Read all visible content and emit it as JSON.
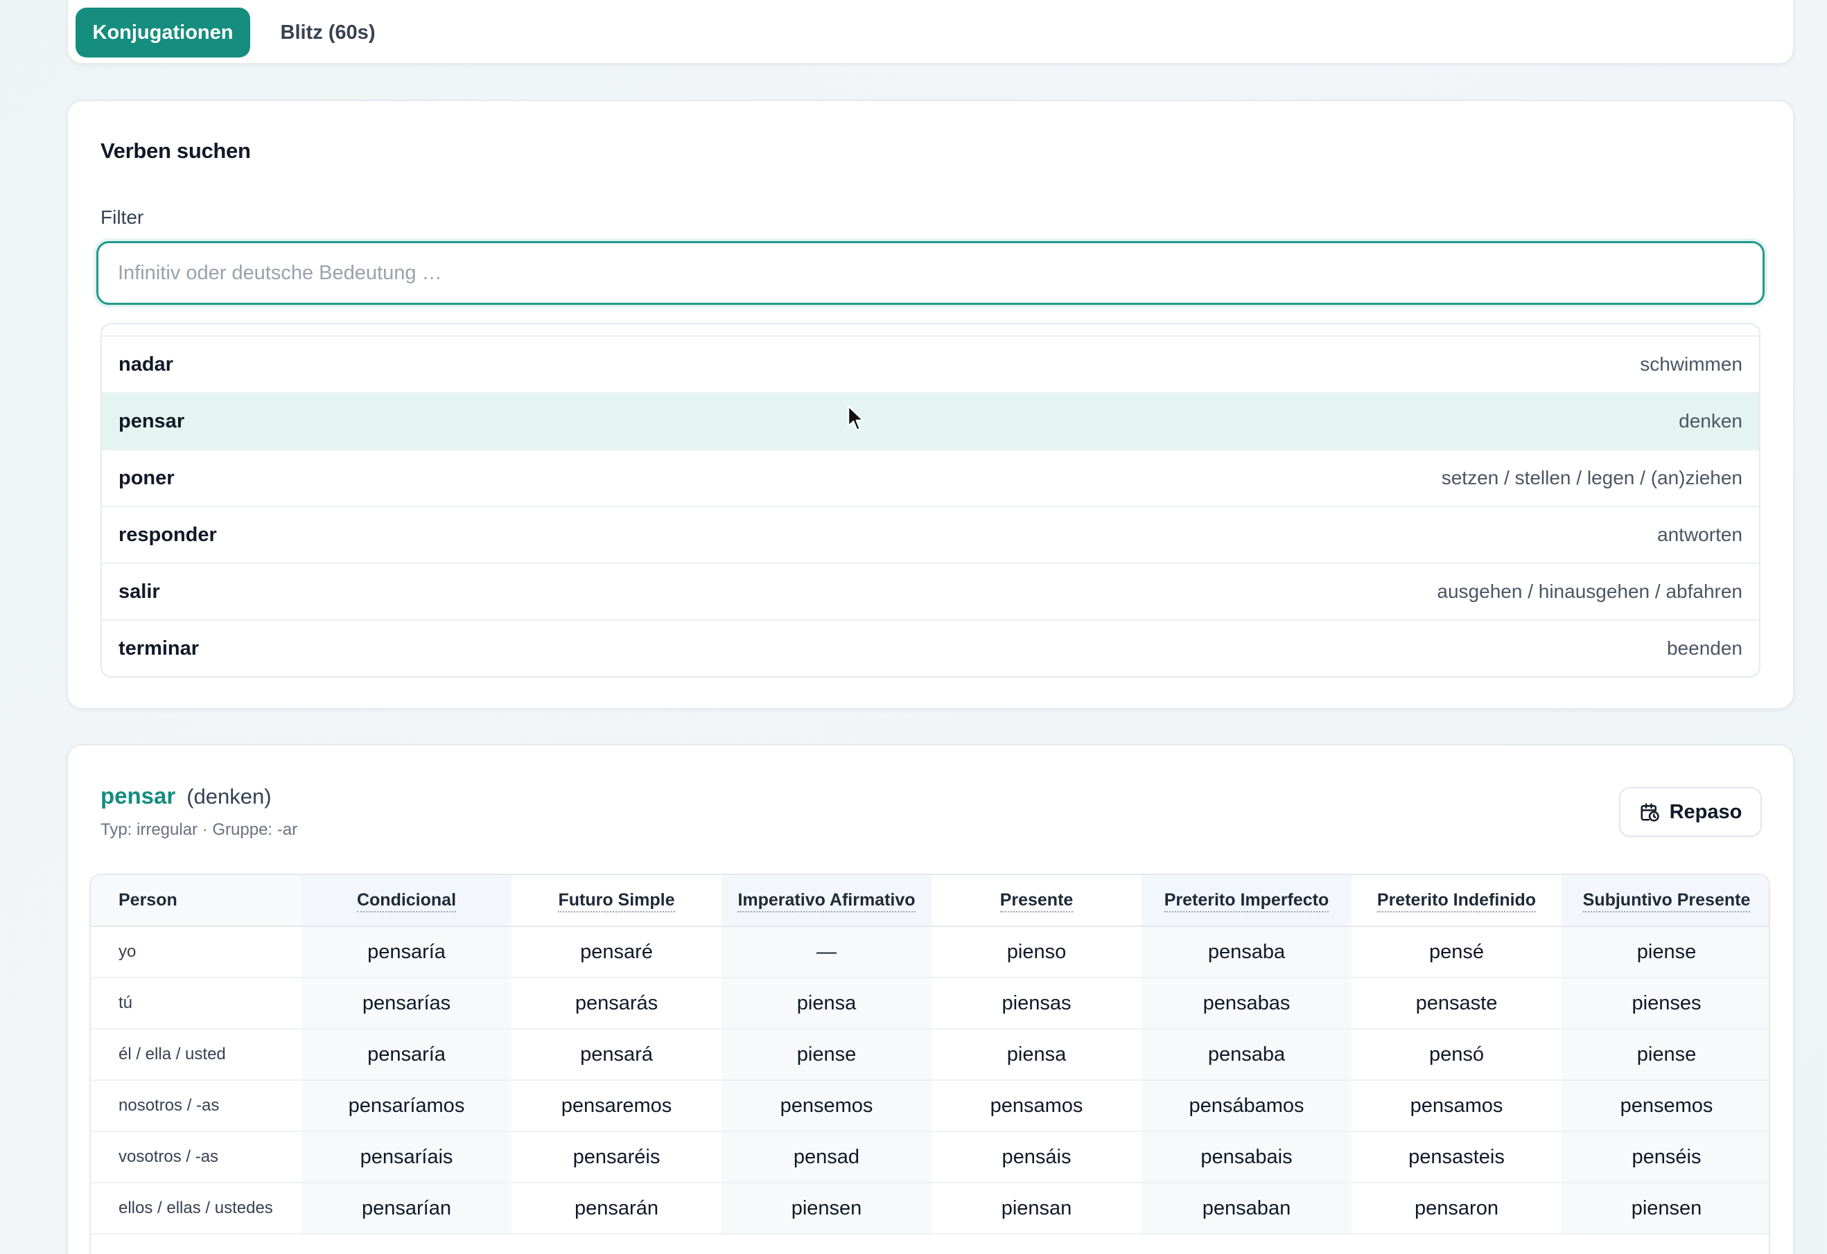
{
  "tabs": [
    {
      "label": "Konjugationen",
      "active": true
    },
    {
      "label": "Blitz (60s)",
      "active": false
    }
  ],
  "search": {
    "title": "Verben suchen",
    "filter_label": "Filter",
    "placeholder": "Infinitiv oder deutsche Bedeutung …",
    "value": "",
    "results": [
      {
        "verb": "nadar",
        "meaning": "schwimmen"
      },
      {
        "verb": "pensar",
        "meaning": "denken",
        "selected": true
      },
      {
        "verb": "poner",
        "meaning": "setzen / stellen / legen / (an)ziehen"
      },
      {
        "verb": "responder",
        "meaning": "antworten"
      },
      {
        "verb": "salir",
        "meaning": "ausgehen / hinausgehen / abfahren"
      },
      {
        "verb": "terminar",
        "meaning": "beenden"
      }
    ]
  },
  "detail": {
    "infinitive": "pensar",
    "meaning": "(denken)",
    "meta": "Typ: irregular · Gruppe: -ar",
    "repaso_label": "Repaso",
    "table": {
      "person_header": "Person",
      "tenses": [
        "Condicional",
        "Futuro Simple",
        "Imperativo Afirmativo",
        "Presente",
        "Preterito Imperfecto",
        "Preterito Indefinido",
        "Subjuntivo Presente"
      ],
      "rows": [
        {
          "person": "yo",
          "forms": [
            "pensaría",
            "pensaré",
            "—",
            "pienso",
            "pensaba",
            "pensé",
            "piense"
          ]
        },
        {
          "person": "tú",
          "forms": [
            "pensarías",
            "pensarás",
            "piensa",
            "piensas",
            "pensabas",
            "pensaste",
            "pienses"
          ]
        },
        {
          "person": "él / ella / usted",
          "forms": [
            "pensaría",
            "pensará",
            "piense",
            "piensa",
            "pensaba",
            "pensó",
            "piense"
          ]
        },
        {
          "person": "nosotros / -as",
          "forms": [
            "pensaríamos",
            "pensaremos",
            "pensemos",
            "pensamos",
            "pensábamos",
            "pensamos",
            "pensemos"
          ]
        },
        {
          "person": "vosotros / -as",
          "forms": [
            "pensaríais",
            "pensaréis",
            "pensad",
            "pensáis",
            "pensabais",
            "pensasteis",
            "penséis"
          ]
        },
        {
          "person": "ellos / ellas / ustedes",
          "forms": [
            "pensarían",
            "pensarán",
            "piensen",
            "piensan",
            "pensaban",
            "pensaron",
            "piensen"
          ]
        }
      ]
    }
  },
  "icons": {
    "repaso": "calendar-clock-icon",
    "pointer": "mouse-cursor-icon"
  },
  "colors": {
    "accent": "#158d7f",
    "selected_row": "#e4f5f1",
    "input_focus": "#1e9a8b"
  }
}
